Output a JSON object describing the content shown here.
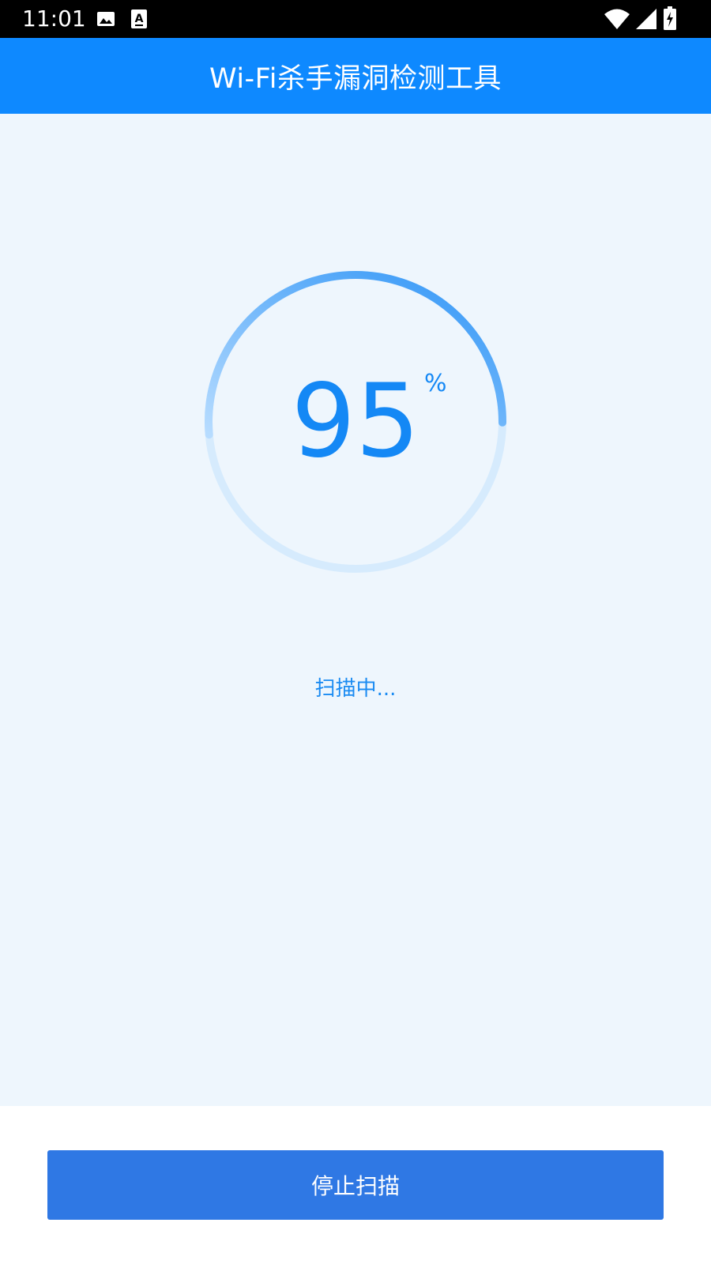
{
  "status_bar": {
    "time": "11:01",
    "icons": [
      "image-icon",
      "keyboard-a-icon",
      "wifi-icon",
      "signal-icon",
      "battery-charging-icon"
    ]
  },
  "app_bar": {
    "title": "Wi-Fi杀手漏洞检测工具"
  },
  "scan": {
    "progress_value": "95",
    "progress_fraction": 0.95,
    "progress_unit": "%",
    "status_text": "扫描中..."
  },
  "actions": {
    "stop_label": "停止扫描"
  },
  "colors": {
    "primary": "#0E89FF",
    "button": "#2F78E4",
    "background": "#EEF6FD",
    "ring_track": "#D6EBFD",
    "ring_progress_start": "#B7DCFF",
    "ring_progress_end": "#2E94F6"
  }
}
